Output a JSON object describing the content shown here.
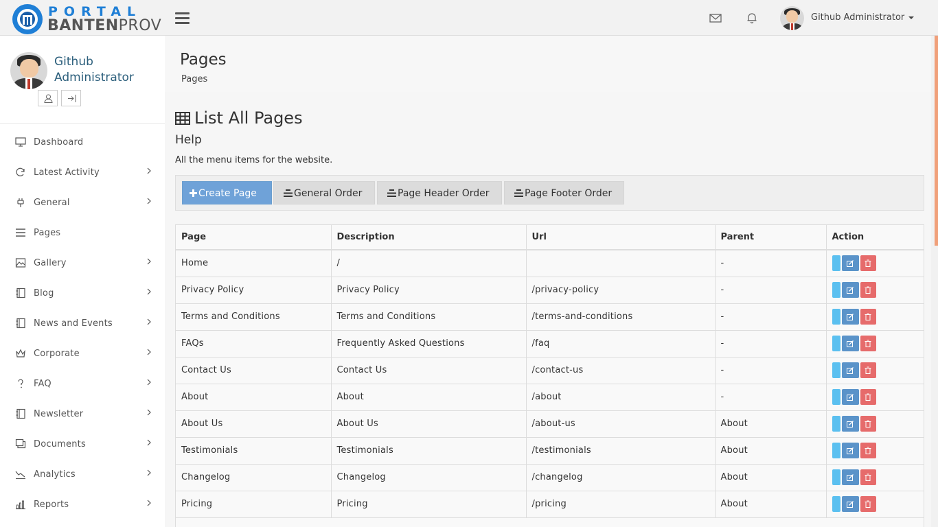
{
  "header": {
    "logo_top": "PORTAL",
    "logo_bottom_bold": "BANTEN",
    "logo_bottom_light": "PROV",
    "user_name": "Github Administrator"
  },
  "sidebar": {
    "profile_name": "Github Administrator",
    "items": [
      {
        "label": "Dashboard",
        "icon": "monitor-icon",
        "has_children": false
      },
      {
        "label": "Latest Activity",
        "icon": "refresh-icon",
        "has_children": true
      },
      {
        "label": "General",
        "icon": "plug-icon",
        "has_children": true
      },
      {
        "label": "Pages",
        "icon": "list-icon",
        "has_children": false
      },
      {
        "label": "Gallery",
        "icon": "image-icon",
        "has_children": true
      },
      {
        "label": "Blog",
        "icon": "notebook-icon",
        "has_children": true
      },
      {
        "label": "News and Events",
        "icon": "notebook-icon",
        "has_children": true
      },
      {
        "label": "Corporate",
        "icon": "crown-icon",
        "has_children": true
      },
      {
        "label": "FAQ",
        "icon": "question-icon",
        "has_children": true
      },
      {
        "label": "Newsletter",
        "icon": "notebook-icon",
        "has_children": true
      },
      {
        "label": "Documents",
        "icon": "documents-icon",
        "has_children": true
      },
      {
        "label": "Analytics",
        "icon": "trend-icon",
        "has_children": true
      },
      {
        "label": "Reports",
        "icon": "bar-chart-icon",
        "has_children": true
      }
    ]
  },
  "content_header": {
    "title": "Pages",
    "breadcrumb": "Pages"
  },
  "main": {
    "list_title": "List All Pages",
    "help_title": "Help",
    "help_text": "All the menu items for the website.",
    "buttons": {
      "create": "Create Page",
      "general_order": "General Order",
      "header_order": "Page Header Order",
      "footer_order": "Page Footer Order"
    },
    "table": {
      "columns": [
        "Page",
        "Description",
        "Url",
        "Parent",
        "Action"
      ],
      "rows": [
        {
          "page": "Home",
          "description": "/",
          "url": "",
          "parent": "-"
        },
        {
          "page": "Privacy Policy",
          "description": "Privacy Policy",
          "url": "/privacy-policy",
          "parent": "-"
        },
        {
          "page": "Terms and Conditions",
          "description": "Terms and Conditions",
          "url": "/terms-and-conditions",
          "parent": "-"
        },
        {
          "page": "FAQs",
          "description": "Frequently Asked Questions",
          "url": "/faq",
          "parent": "-"
        },
        {
          "page": "Contact Us",
          "description": "Contact Us",
          "url": "/contact-us",
          "parent": "-"
        },
        {
          "page": "About",
          "description": "About",
          "url": "/about",
          "parent": "-"
        },
        {
          "page": "About Us",
          "description": "About Us",
          "url": "/about-us",
          "parent": "About"
        },
        {
          "page": "Testimonials",
          "description": "Testimonials",
          "url": "/testimonials",
          "parent": "About"
        },
        {
          "page": "Changelog",
          "description": "Changelog",
          "url": "/changelog",
          "parent": "About"
        },
        {
          "page": "Pricing",
          "description": "Pricing",
          "url": "/pricing",
          "parent": "About"
        }
      ]
    }
  },
  "colors": {
    "brand_blue": "#1f7fd6",
    "primary_button": "#6fa2d8",
    "view_button": "#5bc0f0",
    "edit_button": "#5a93c9",
    "delete_button": "#e66b6b",
    "scrollbar_thumb": "#f0a07a"
  }
}
